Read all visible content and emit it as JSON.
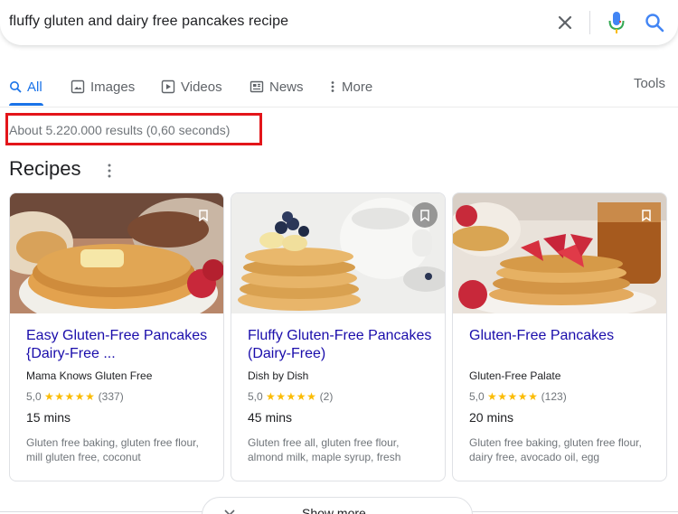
{
  "search": {
    "query": "fluffy gluten and dairy free pancakes recipe"
  },
  "tabs": [
    {
      "label": "All",
      "icon": "search-icon",
      "active": true
    },
    {
      "label": "Images",
      "icon": "image-icon"
    },
    {
      "label": "Videos",
      "icon": "play-icon"
    },
    {
      "label": "News",
      "icon": "news-icon"
    },
    {
      "label": "More",
      "icon": "more-vert-icon"
    }
  ],
  "tools_label": "Tools",
  "result_stats": "About 5.220.000 results (0,60 seconds)",
  "section_title": "Recipes",
  "recipes": [
    {
      "title": "Easy Gluten-Free Pancakes {Dairy-Free ...",
      "source": "Mama Knows Gluten Free",
      "rating": "5,0",
      "stars": "★★★★★",
      "reviews": "(337)",
      "time": "15 mins",
      "ingredients": "Gluten free baking, gluten free flour, mill gluten free, coconut"
    },
    {
      "title": "Fluffy Gluten-Free Pancakes (Dairy-Free)",
      "source": "Dish by Dish",
      "rating": "5,0",
      "stars": "★★★★★",
      "reviews": "(2)",
      "time": "45 mins",
      "ingredients": "Gluten free all, gluten free flour, almond milk, maple syrup, fresh"
    },
    {
      "title": "Gluten-Free Pancakes",
      "source": "Gluten-Free Palate",
      "rating": "5,0",
      "stars": "★★★★★",
      "reviews": "(123)",
      "time": "20 mins",
      "ingredients": "Gluten free baking, gluten free flour, dairy free, avocado oil, egg"
    }
  ],
  "show_more_label": "Show more",
  "colors": {
    "accent": "#1a73e8",
    "link": "#1a0dab",
    "star": "#fbbc04",
    "highlight": "#e3151a"
  }
}
